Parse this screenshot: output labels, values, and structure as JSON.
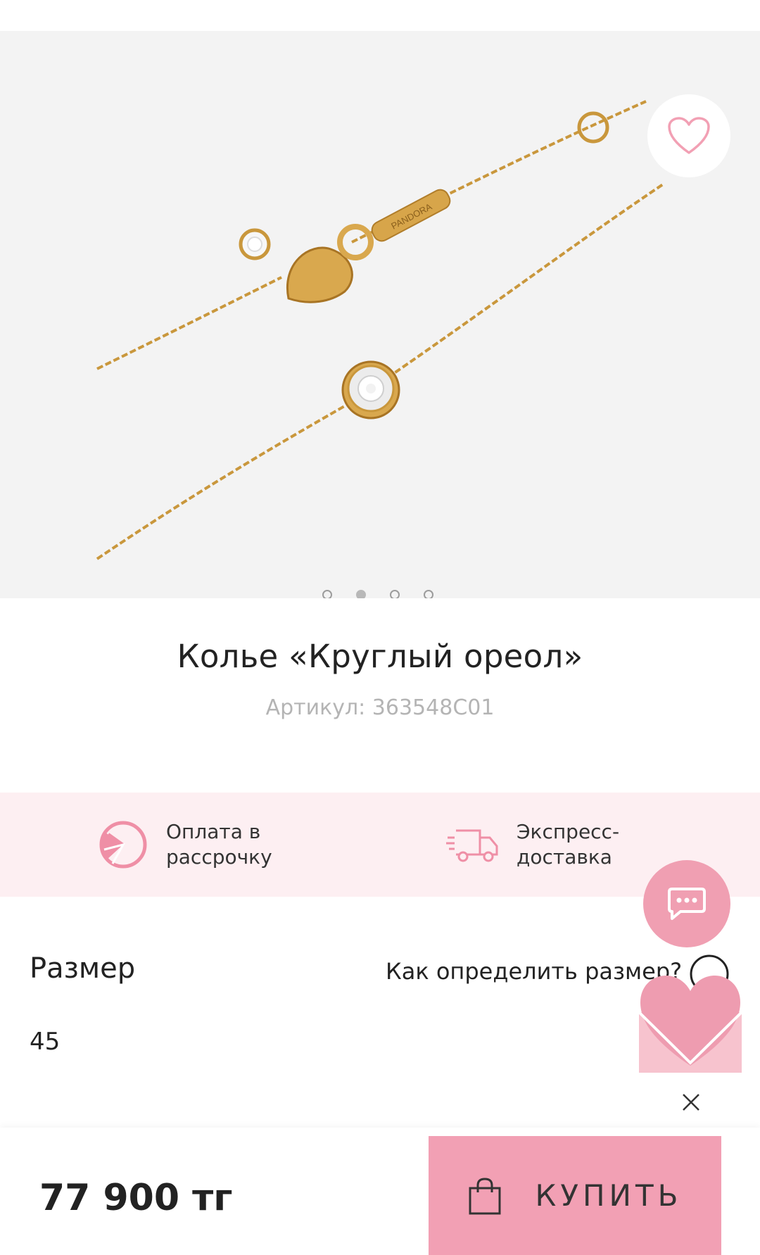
{
  "gallery": {
    "image_icon": "necklace-product-photo",
    "clasp_engraving": "PANDORA",
    "pagination": {
      "total": 4,
      "active_index": 1
    },
    "wishlist_icon": "heart-outline-icon"
  },
  "product": {
    "title": "Колье «Круглый ореол»",
    "sku": "Артикул: 363548C01"
  },
  "benefits": [
    {
      "icon": "installment-pie-icon",
      "label": "Оплата в рассрочку"
    },
    {
      "icon": "delivery-truck-icon",
      "label": "Экспресс-доставка"
    }
  ],
  "size": {
    "label": "Размер",
    "help_link": "Как определить размер?",
    "value": "45"
  },
  "floating": {
    "chat_icon": "chat-bubble-icon",
    "promo_icon": "heart-envelope-icon",
    "close_icon": "close-icon"
  },
  "purchase": {
    "price": "77 900 тг",
    "buy_label": "КУПИТЬ",
    "bag_icon": "shopping-bag-icon"
  },
  "colors": {
    "accent_pink": "#f2a0b4",
    "benefits_bg": "#fdeff2",
    "gallery_bg": "#f3f3f3",
    "gold": "#c9973c"
  }
}
